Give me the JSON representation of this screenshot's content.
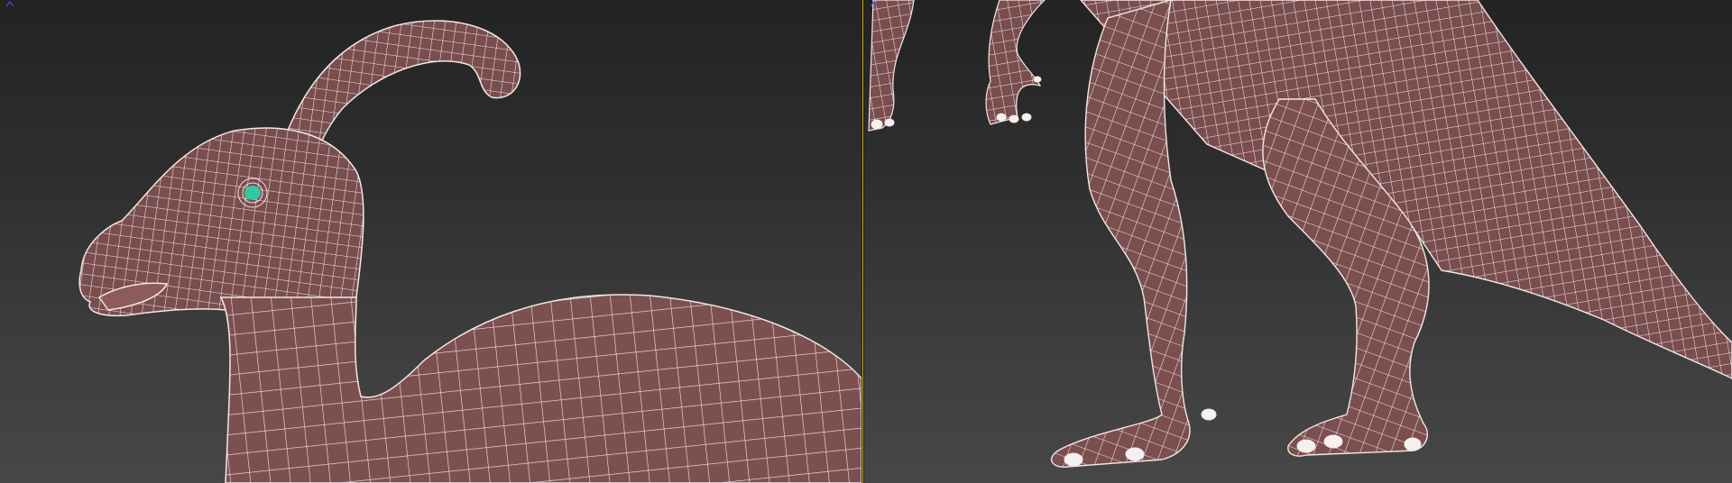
{
  "app": {
    "type": "3d-modeling-viewport-split"
  },
  "viewports": [
    {
      "id": "left",
      "content": "parasaurolophus-head-closeup",
      "shading": "smooth-with-wireframe-edges",
      "mesh_color": "#7a4e4e",
      "wire_color": "#f2e8e8",
      "eye_color": "#33c7a3",
      "active": false
    },
    {
      "id": "right",
      "content": "parasaurolophus-legs-and-tail",
      "shading": "smooth-with-wireframe-edges",
      "mesh_color": "#7a4e4e",
      "wire_color": "#f2e8e8",
      "active": true,
      "active_border_color": "#c8b400"
    }
  ],
  "colors": {
    "viewport_bg_top": "#232323",
    "viewport_bg_bottom": "#474747",
    "active_border": "#c8b400",
    "axis_gizmo": "#3a4cd6"
  },
  "icons": {
    "axis_gizmo": "axis-gizmo-icon"
  }
}
